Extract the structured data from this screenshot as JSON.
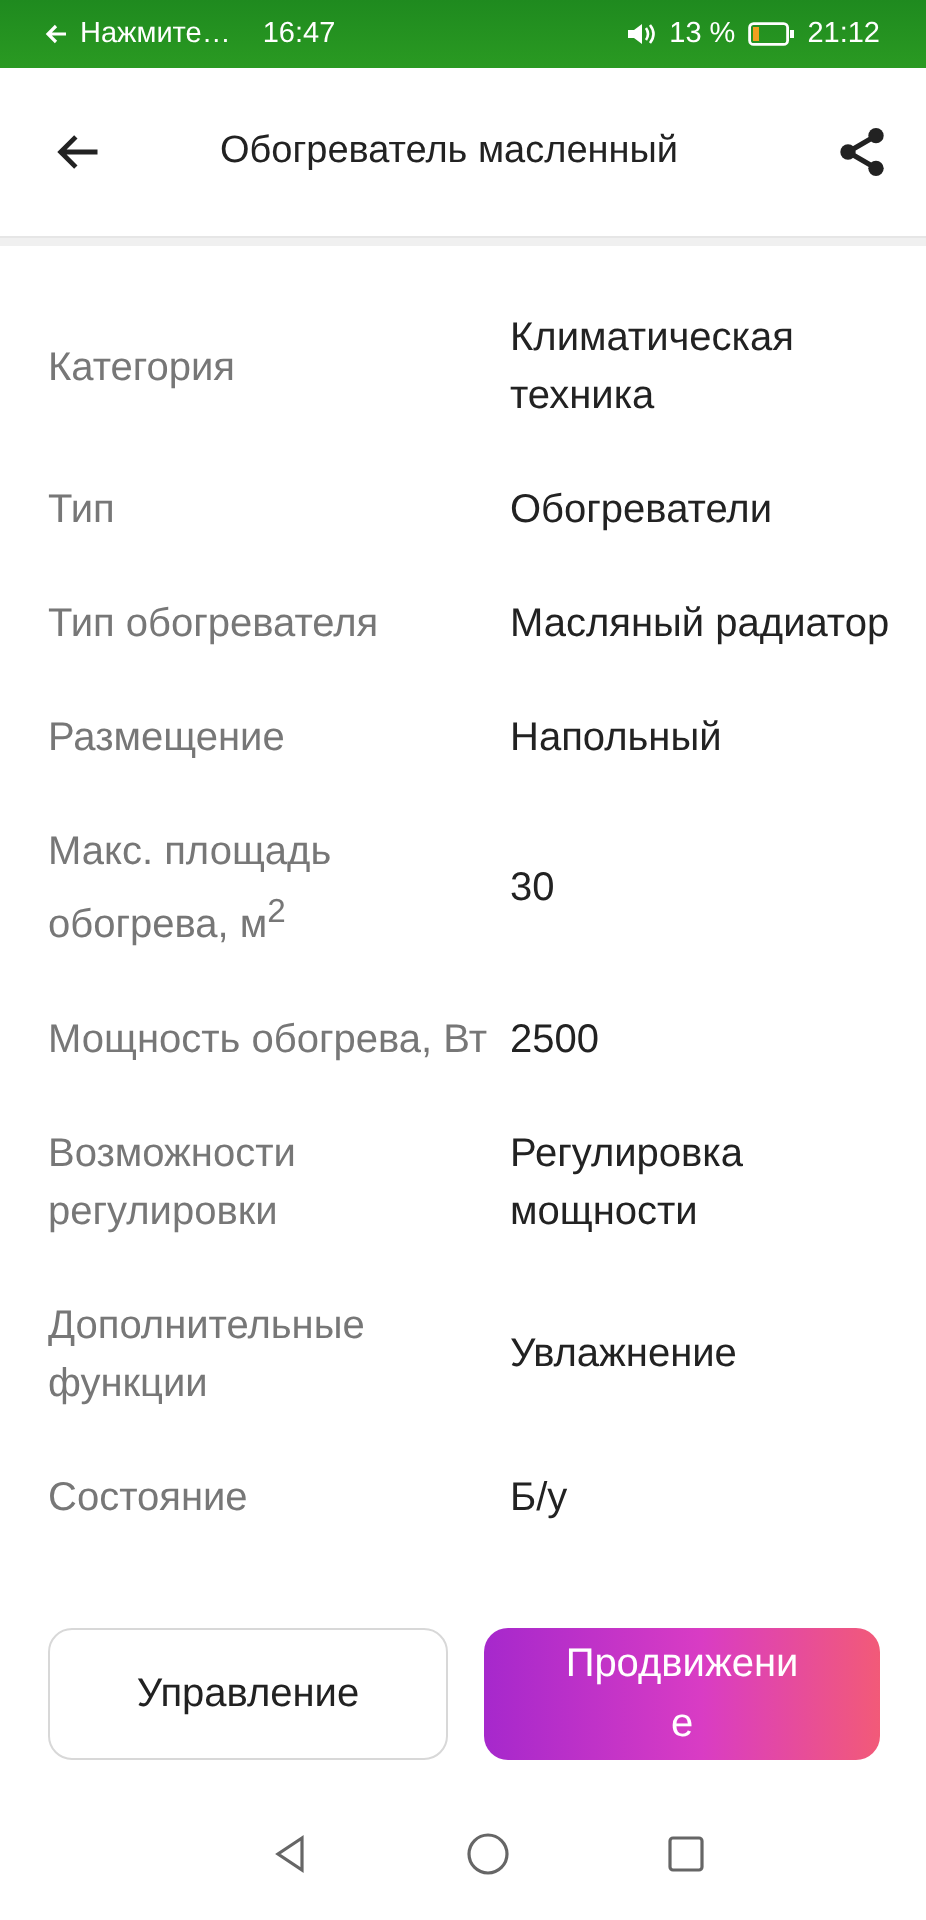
{
  "status_bar": {
    "notification": "Нажмите…",
    "notification_time": "16:47",
    "battery": "13 %",
    "time": "21:12"
  },
  "app_bar": {
    "title": "Обогреватель масленный"
  },
  "specs": [
    {
      "label": "Категория",
      "value": "Климатическая техника"
    },
    {
      "label": "Тип",
      "value": "Обогреватели"
    },
    {
      "label": "Тип обогревателя",
      "value": "Масляный радиатор"
    },
    {
      "label": "Размещение",
      "value": "Напольный"
    },
    {
      "label": "Макс. площадь обогрева, м$^{2}$",
      "value": "30"
    },
    {
      "label": "Мощность обогрева, Вт",
      "value": "2500"
    },
    {
      "label": "Возможности регулировки",
      "value": "Регулировка мощности"
    },
    {
      "label": "Дополнительные функции",
      "value": "Увлажнение"
    },
    {
      "label": "Состояние",
      "value": "Б/у"
    }
  ],
  "buttons": [
    {
      "label": "Управление",
      "kind": "outline"
    },
    {
      "label": "Продвижение",
      "kind": "gradient"
    }
  ]
}
